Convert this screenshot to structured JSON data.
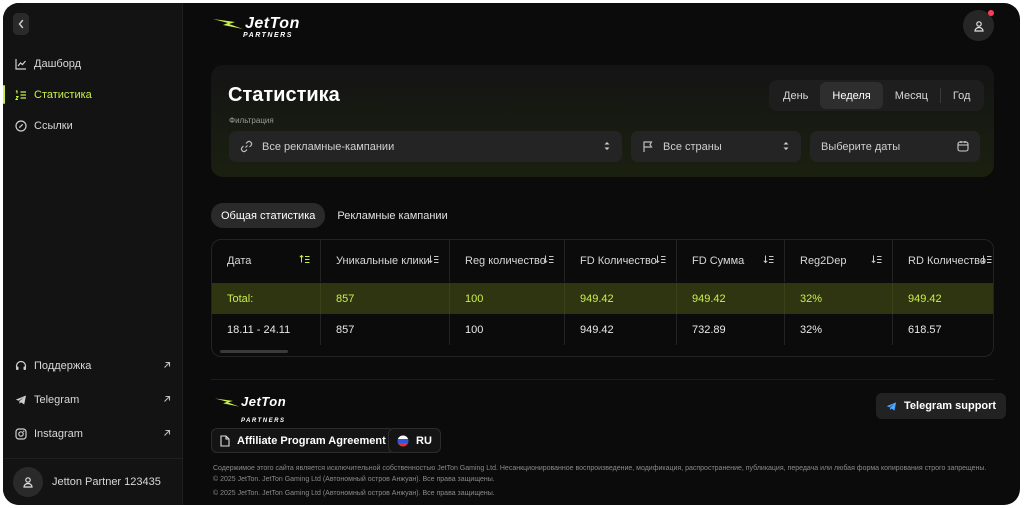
{
  "brand": {
    "logo_main": "JetTon",
    "logo_sub": "PARTNERS",
    "accent": "#c8f04a"
  },
  "sidebar": {
    "items": [
      {
        "label": "Дашборд",
        "icon": "chart-icon"
      },
      {
        "label": "Статистика",
        "icon": "list-sort-icon",
        "active": true
      },
      {
        "label": "Ссылки",
        "icon": "link-circle-icon"
      }
    ],
    "bottom_items": [
      {
        "label": "Поддержка",
        "icon": "headset-icon"
      },
      {
        "label": "Telegram",
        "icon": "telegram-icon"
      },
      {
        "label": "Instagram",
        "icon": "instagram-icon"
      }
    ],
    "user_name": "Jetton Partner 123435"
  },
  "page": {
    "title": "Статистика",
    "periods": [
      "День",
      "Неделя",
      "Месяц",
      "Год"
    ],
    "active_period": "Неделя",
    "filter_label": "Фильтрация",
    "filters": {
      "campaigns": "Все рекламные-кампании",
      "countries": "Все страны",
      "dates_placeholder": "Выберите даты"
    },
    "tabs": [
      "Общая статистика",
      "Рекламные кампании"
    ],
    "active_tab": "Общая статистика"
  },
  "table": {
    "columns": [
      "Дата",
      "Уникальные клики",
      "Reg количество",
      "FD Количество",
      "FD Сумма",
      "Reg2Dep",
      "RD Количество"
    ],
    "total": [
      "Total:",
      "857",
      "100",
      "949.42",
      "949.42",
      "32%",
      "949.42"
    ],
    "rows": [
      [
        "18.11 - 24.11",
        "857",
        "100",
        "949.42",
        "732.89",
        "32%",
        "618.57"
      ]
    ]
  },
  "footer": {
    "telegram_support": "Telegram support",
    "agreement": "Affiliate Program Agreement",
    "language": "RU",
    "legal": "Содержимое этого сайта является исключительной собственностью JetTon Gaming Ltd. Несанкционированное воспроизведение, модификация, распространение, публикация, передача или любая форма копирования строго запрещены. © 2025 JetTon. JetTon Gaming Ltd (Автономный остров Анжуан). Все права защищены.",
    "copyright": "© 2025 JetTon. JetTon Gaming Ltd (Автономный остров Анжуан). Все права защищены."
  }
}
